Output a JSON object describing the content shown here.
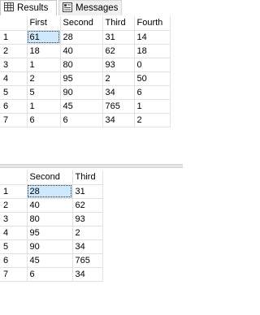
{
  "tabs": [
    {
      "label": "Results",
      "icon": "grid-icon",
      "active": true
    },
    {
      "label": "Messages",
      "icon": "messages-icon",
      "active": false
    }
  ],
  "grid1": {
    "columns": [
      "First",
      "Second",
      "Third",
      "Fourth"
    ],
    "rows": [
      {
        "num": "1",
        "cells": [
          "61",
          "28",
          "31",
          "14"
        ]
      },
      {
        "num": "2",
        "cells": [
          "18",
          "40",
          "62",
          "18"
        ]
      },
      {
        "num": "3",
        "cells": [
          "1",
          "80",
          "93",
          "0"
        ]
      },
      {
        "num": "4",
        "cells": [
          "2",
          "95",
          "2",
          "50"
        ]
      },
      {
        "num": "5",
        "cells": [
          "5",
          "90",
          "34",
          "6"
        ]
      },
      {
        "num": "6",
        "cells": [
          "1",
          "45",
          "765",
          "1"
        ]
      },
      {
        "num": "7",
        "cells": [
          "6",
          "6",
          "34",
          "2"
        ]
      }
    ]
  },
  "grid2": {
    "columns": [
      "Second",
      "Third"
    ],
    "rows": [
      {
        "num": "1",
        "cells": [
          "28",
          "31"
        ]
      },
      {
        "num": "2",
        "cells": [
          "40",
          "62"
        ]
      },
      {
        "num": "3",
        "cells": [
          "80",
          "93"
        ]
      },
      {
        "num": "4",
        "cells": [
          "95",
          "2"
        ]
      },
      {
        "num": "5",
        "cells": [
          "90",
          "34"
        ]
      },
      {
        "num": "6",
        "cells": [
          "45",
          "765"
        ]
      },
      {
        "num": "7",
        "cells": [
          "6",
          "34"
        ]
      }
    ]
  }
}
